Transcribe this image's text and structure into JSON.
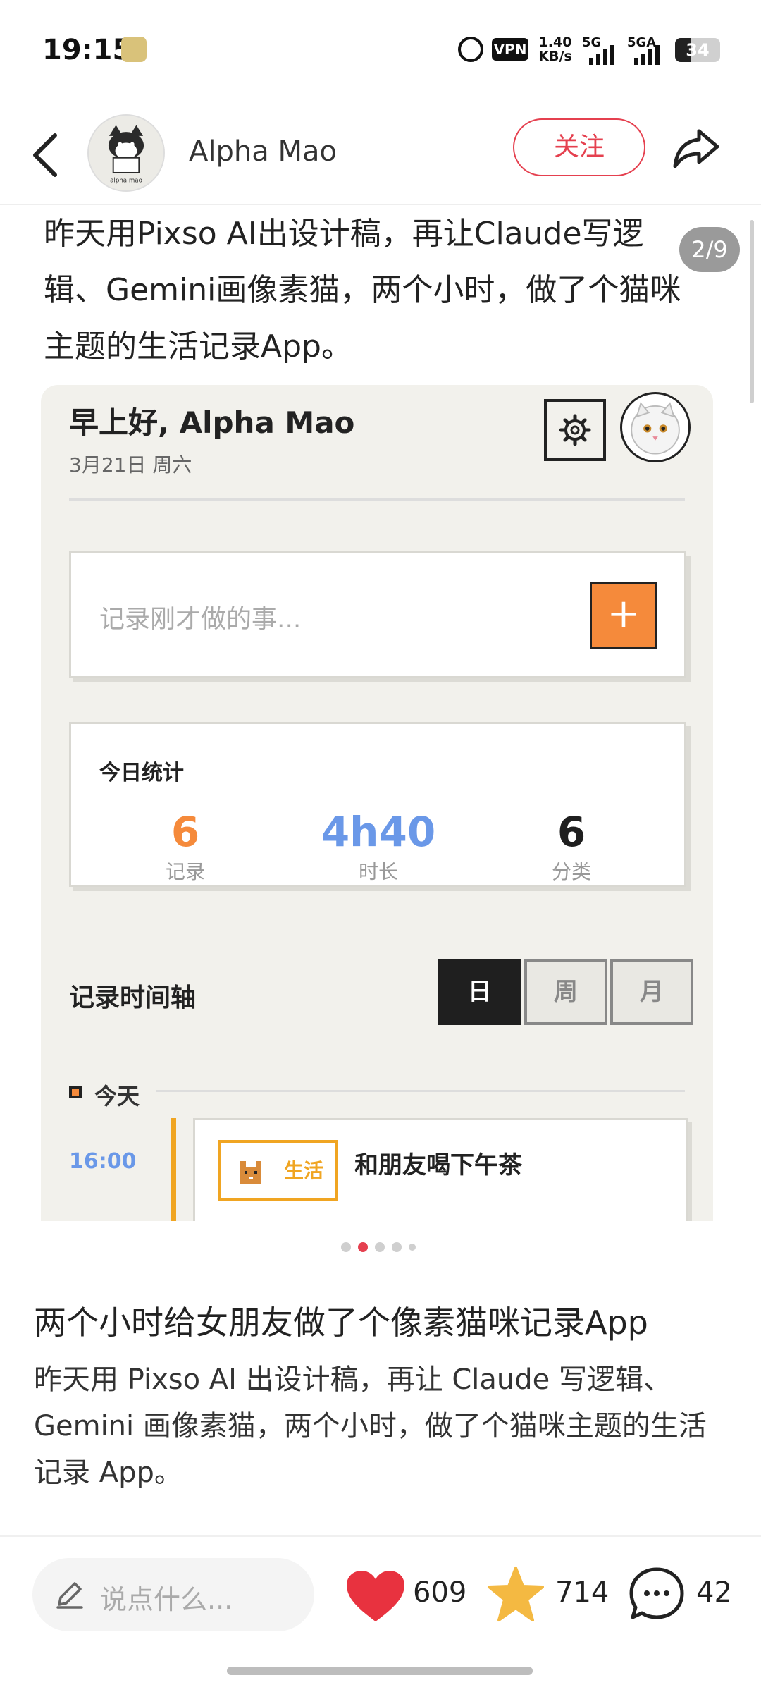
{
  "status_bar": {
    "time": "19:15",
    "vpn": "VPN",
    "net_speed_value": "1.40",
    "net_speed_unit": "KB/s",
    "signal1_label": "5G",
    "signal2_label": "5GA",
    "battery_text": "34",
    "battery_level_percent": 34
  },
  "header": {
    "author_name": "Alpha Mao",
    "follow_label": "关注",
    "avatar_caption": "alpha mao"
  },
  "carousel": {
    "page_indicator": "2/9",
    "caption": "昨天用Pixso AI出设计稿，再让Claude写逻辑、Gemini画像素猫，两个小时，做了个猫咪主题的生活记录App。",
    "dots_count": 5,
    "active_dot": 1,
    "mockup": {
      "greeting": "早上好, Alpha Mao",
      "date": "3月21日 周六",
      "record_placeholder": "记录刚才做的事...",
      "add_label": "+",
      "stats_title": "今日统计",
      "stats": [
        {
          "value": "6",
          "label": "记录",
          "color": "#f58a3b"
        },
        {
          "value": "4h40",
          "label": "时长",
          "color": "#6a98e8"
        },
        {
          "value": "6",
          "label": "分类",
          "color": "#1f1f1f"
        }
      ],
      "timeline_title": "记录时间轴",
      "periods": [
        "日",
        "周",
        "月"
      ],
      "active_period": 0,
      "today_label": "今天",
      "event": {
        "time": "16:00",
        "category": "生活",
        "title": "和朋友喝下午茶"
      }
    }
  },
  "post": {
    "title": "两个小时给女朋友做了个像素猫咪记录App",
    "body": "昨天用 Pixso AI 出设计稿，再让 Claude 写逻辑、Gemini 画像素猫，两个小时，做了个猫咪主题的生活记录 App。"
  },
  "bottom_bar": {
    "comment_placeholder": "说点什么...",
    "like_count": "609",
    "fav_count": "714",
    "comment_count": "42"
  },
  "colors": {
    "accent_red": "#e5404f",
    "like_red": "#e8323f",
    "star_yellow": "#f4b942",
    "mock_orange": "#f58a3b",
    "mock_blue": "#6a98e8"
  },
  "icons": [
    "back-icon",
    "share-icon",
    "alarm-icon",
    "gear-icon",
    "plus-icon",
    "pencil-icon",
    "heart-icon",
    "star-icon",
    "comment-icon"
  ]
}
